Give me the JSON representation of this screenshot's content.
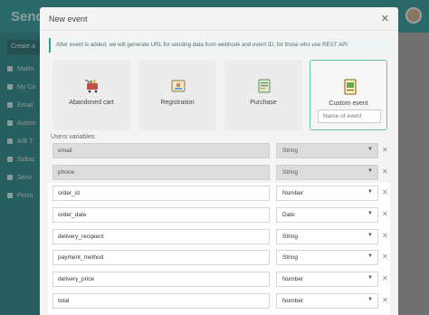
{
  "background": {
    "brand": "Send",
    "create_label": "Create a",
    "nav": [
      "Mailin",
      "My Co",
      "Email",
      "Autom",
      "A/B T",
      "Subsc",
      "Servi",
      "Pricin"
    ]
  },
  "modal": {
    "title": "New event",
    "info": "After event is added, we will generate URL for sending data from webhook and event ID, for those who use REST API"
  },
  "event_types": [
    {
      "label": "Abandoned cart",
      "icon": "shopping-cart-icon"
    },
    {
      "label": "Registration",
      "icon": "id-card-icon"
    },
    {
      "label": "Purchase",
      "icon": "receipt-icon"
    },
    {
      "label": "Custom event",
      "icon": "custom-document-icon",
      "selected": true
    }
  ],
  "custom_event_placeholder": "Name of event",
  "variables_title": "Users variables:",
  "variables": [
    {
      "name": "email",
      "type": "String",
      "locked": true
    },
    {
      "name": "phone",
      "type": "String",
      "locked": true
    },
    {
      "name": "order_id",
      "type": "Number",
      "locked": false
    },
    {
      "name": "order_date",
      "type": "Date",
      "locked": false
    },
    {
      "name": "delivery_recipient",
      "type": "String",
      "locked": false
    },
    {
      "name": "payment_method",
      "type": "String",
      "locked": false
    },
    {
      "name": "delivery_price",
      "type": "Number",
      "locked": false
    },
    {
      "name": "total",
      "type": "Number",
      "locked": false
    }
  ],
  "colors": {
    "accent": "#2aa198",
    "selected_border": "#6dc4a0",
    "sidebar": "#167a7c"
  }
}
